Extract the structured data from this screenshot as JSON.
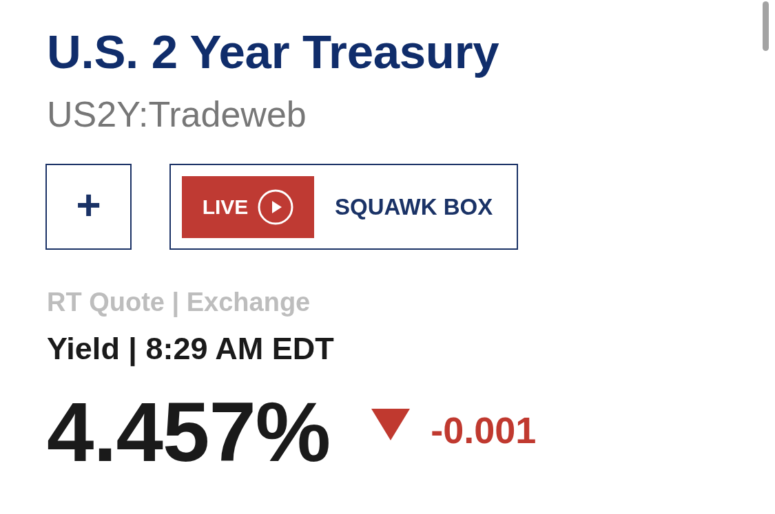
{
  "title": "U.S. 2 Year Treasury",
  "symbol": "US2Y:Tradeweb",
  "actions": [
    {
      "kind": "add",
      "label": "+"
    },
    {
      "kind": "live",
      "badge": "LIVE",
      "label": "SQUAWK BOX"
    }
  ],
  "quote_source": "RT Quote | Exchange",
  "quote_time": "Yield | 8:29 AM EDT",
  "price": {
    "value": "4.457%",
    "falling": true,
    "change": "-0.001"
  }
}
